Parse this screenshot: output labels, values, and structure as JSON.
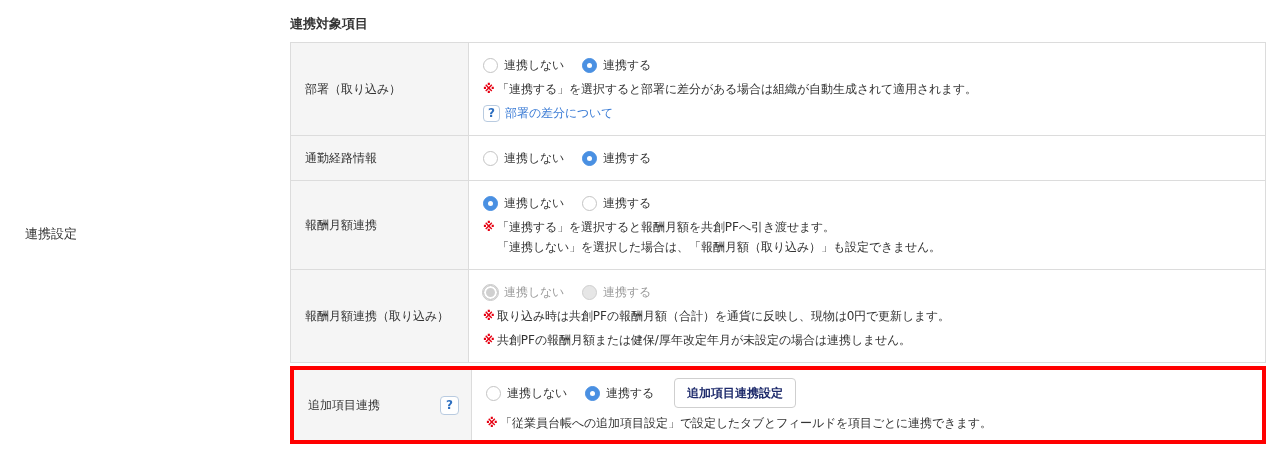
{
  "section_label": "連携設定",
  "table": {
    "title": "連携対象項目",
    "rows": [
      {
        "label": "部署（取り込み）",
        "highlighted": false,
        "options": [
          {
            "label": "連携しない",
            "selected": false,
            "disabled": false
          },
          {
            "label": "連携する",
            "selected": true,
            "disabled": false
          }
        ],
        "notes": [
          {
            "mark": "※",
            "lines": [
              "「連携する」を選択すると部署に差分がある場合は組織が自動生成されて適用されます。"
            ]
          }
        ],
        "help_link": {
          "icon": "?",
          "text": "部署の差分について"
        }
      },
      {
        "label": "通勤経路情報",
        "highlighted": false,
        "options": [
          {
            "label": "連携しない",
            "selected": false,
            "disabled": false
          },
          {
            "label": "連携する",
            "selected": true,
            "disabled": false
          }
        ]
      },
      {
        "label": "報酬月額連携",
        "highlighted": false,
        "options": [
          {
            "label": "連携しない",
            "selected": true,
            "disabled": false
          },
          {
            "label": "連携する",
            "selected": false,
            "disabled": false
          }
        ],
        "notes": [
          {
            "mark": "※",
            "lines": [
              "「連携する」を選択すると報酬月額を共創PFへ引き渡せます。",
              "「連携しない」を選択した場合は、「報酬月額（取り込み）」も設定できません。"
            ]
          }
        ]
      },
      {
        "label": "報酬月額連携（取り込み）",
        "highlighted": false,
        "options": [
          {
            "label": "連携しない",
            "selected": true,
            "disabled": true
          },
          {
            "label": "連携する",
            "selected": false,
            "disabled": true
          }
        ],
        "notes": [
          {
            "mark": "※",
            "lines": [
              "取り込み時は共創PFの報酬月額（合計）を通貨に反映し、現物は0円で更新します。"
            ]
          },
          {
            "mark": "※",
            "lines": [
              "共創PFの報酬月額または健保/厚年改定年月が未設定の場合は連携しません。"
            ]
          }
        ]
      },
      {
        "label": "追加項目連携",
        "highlighted": true,
        "help_icon": "?",
        "options": [
          {
            "label": "連携しない",
            "selected": false,
            "disabled": false
          },
          {
            "label": "連携する",
            "selected": true,
            "disabled": false
          }
        ],
        "button": "追加項目連携設定",
        "notes": [
          {
            "mark": "※",
            "lines": [
              "「従業員台帳への追加項目設定」で設定したタブとフィールドを項目ごとに連携できます。"
            ]
          }
        ]
      }
    ]
  }
}
